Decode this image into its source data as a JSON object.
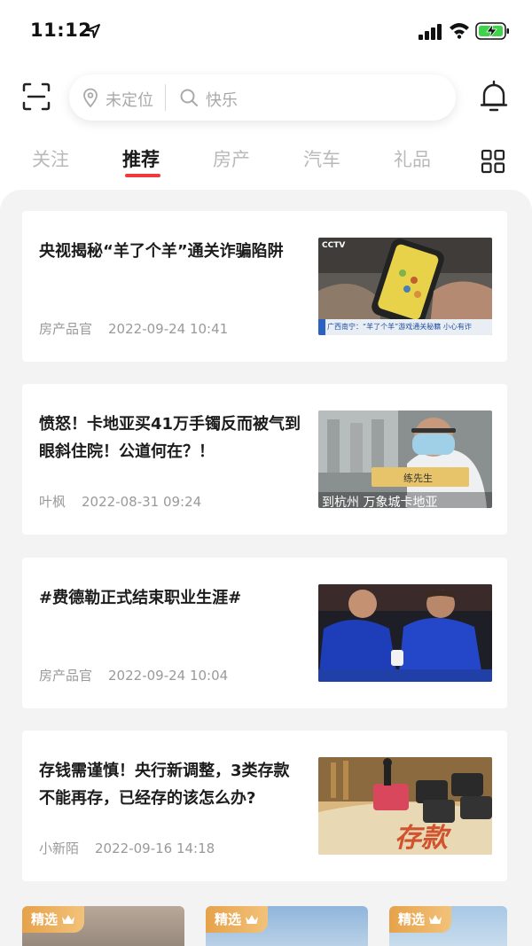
{
  "status_bar": {
    "time": "11:12"
  },
  "search": {
    "location": "未定位",
    "placeholder": "快乐"
  },
  "tabs": [
    {
      "label": "关注",
      "active": false
    },
    {
      "label": "推荐",
      "active": true
    },
    {
      "label": "房产",
      "active": false
    },
    {
      "label": "汽车",
      "active": false
    },
    {
      "label": "礼品",
      "active": false
    }
  ],
  "colors": {
    "accent": "#ee3a3a",
    "badge": "#e6a24a",
    "feed_bg": "#f3f3f3"
  },
  "articles": [
    {
      "title": "央视揭秘“羊了个羊”通关诈骗陷阱",
      "author": "房产品官",
      "date": "2022-09-24 10:41",
      "thumb_caption": "广西南宁：“羊了个羊”游戏通关秘籍 小心有诈",
      "thumb_tag": "CCTV"
    },
    {
      "title": "愤怒！卡地亚买41万手镯反而被气到眼斜住院！公道何在？！",
      "author": "叶枫",
      "date": "2022-08-31 09:24",
      "thumb_caption": "到杭州 万象城卡地亚",
      "thumb_tag": "练先生"
    },
    {
      "title": "#费德勒正式结束职业生涯#",
      "author": "房产品官",
      "date": "2022-09-24 10:04",
      "thumb_caption": "",
      "thumb_tag": ""
    },
    {
      "title": "存钱需谨慎！央行新调整，3类存款不能再存，已经存的该怎么办?",
      "author": "小新陌",
      "date": "2022-09-16 14:18",
      "thumb_caption": "存款",
      "thumb_tag": ""
    }
  ],
  "featured": [
    {
      "badge": "精选"
    },
    {
      "badge": "精选"
    },
    {
      "badge": "精选"
    }
  ]
}
